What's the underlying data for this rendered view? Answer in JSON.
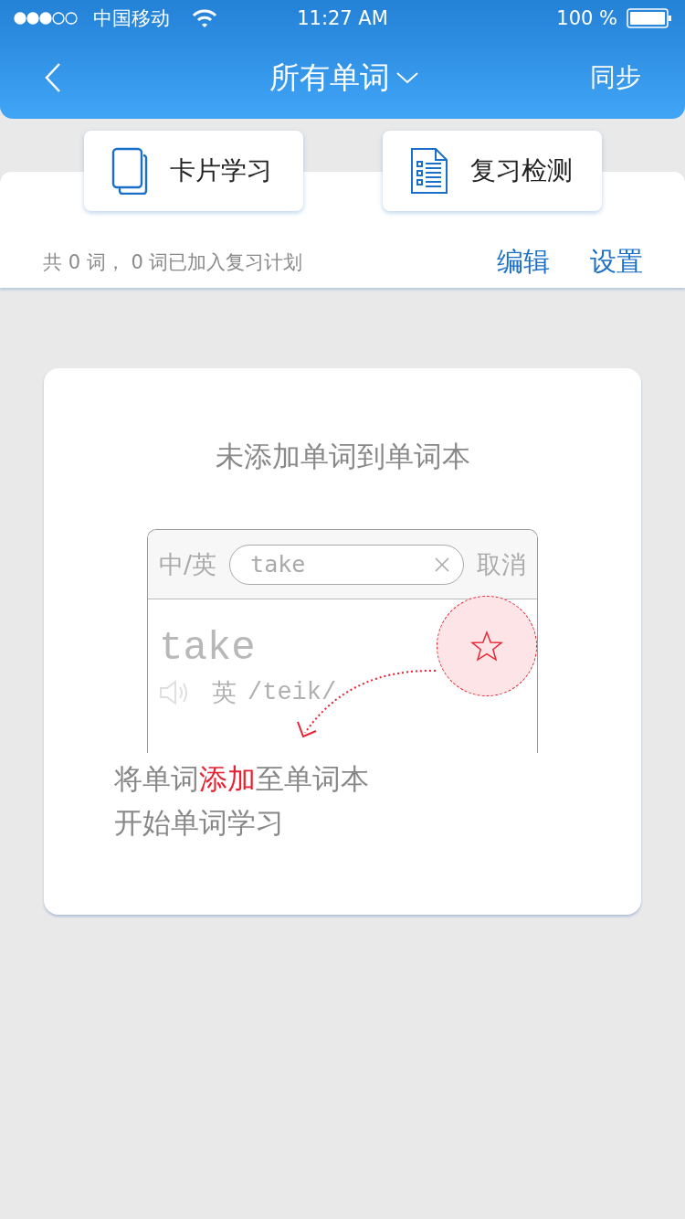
{
  "status_bar": {
    "carrier": "中国移动",
    "time": "11:27 AM",
    "battery": "100 %"
  },
  "nav": {
    "title": "所有单词",
    "action": "同步"
  },
  "modes": [
    {
      "kind": "cards",
      "label": "卡片学习"
    },
    {
      "kind": "review",
      "label": "复习检测"
    }
  ],
  "summary": {
    "text": "共 0 词， 0 词已加入复习计划",
    "actions": [
      "编辑",
      "设置"
    ]
  },
  "empty_card": {
    "title": "未添加单词到单词本",
    "illustration": {
      "language_toggle": "中/英",
      "search_value": "take",
      "cancel": "取消",
      "word": "take",
      "phonetic_label": "英",
      "phonetic": "/teik/"
    },
    "instruction": [
      [
        {
          "text": "将单词",
          "highlight": false
        },
        {
          "text": "添加",
          "highlight": true
        },
        {
          "text": "至单词本",
          "highlight": false
        }
      ],
      [
        {
          "text": "开始单词学习",
          "highlight": false
        }
      ]
    ]
  }
}
